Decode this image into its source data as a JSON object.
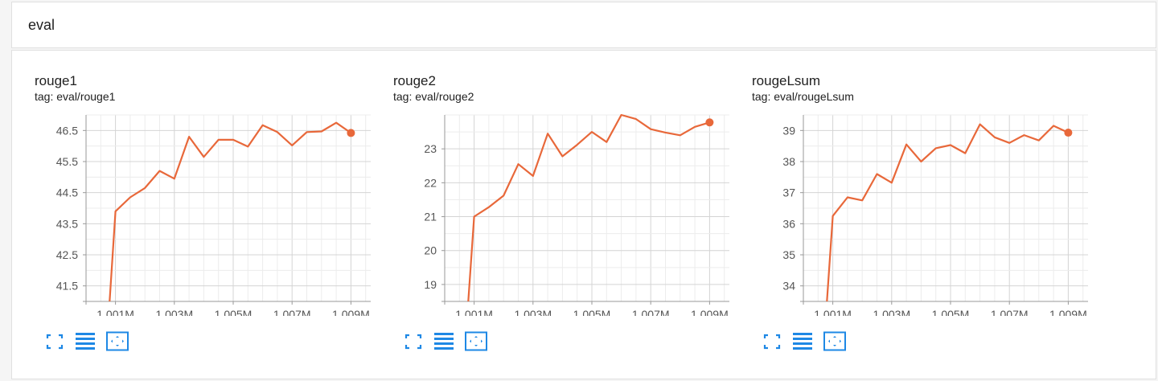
{
  "group": {
    "title": "eval"
  },
  "cards": [
    {
      "title": "rouge1",
      "tag": "tag: eval/rouge1",
      "yticks": [
        "46.5",
        "45.5",
        "44.5",
        "43.5",
        "42.5",
        "41.5"
      ],
      "xticks": [
        "1.001M",
        "1.003M",
        "1.005M",
        "1.007M",
        "1.009M"
      ]
    },
    {
      "title": "rouge2",
      "tag": "tag: eval/rouge2",
      "yticks": [
        "23",
        "22",
        "21",
        "20",
        "19"
      ],
      "xticks": [
        "1.001M",
        "1.003M",
        "1.005M",
        "1.007M",
        "1.009M"
      ]
    },
    {
      "title": "rougeLsum",
      "tag": "tag: eval/rougeLsum",
      "yticks": [
        "39",
        "38",
        "37",
        "36",
        "35",
        "34"
      ],
      "xticks": [
        "1.001M",
        "1.003M",
        "1.005M",
        "1.007M",
        "1.009M"
      ]
    }
  ],
  "actions": {
    "fullscreen_icon": "expand-icon",
    "data_icon": "data-table-icon",
    "fit_icon": "fit-domain-icon"
  },
  "colors": {
    "line": "#e8683a",
    "grid": "#dddddd",
    "axis": "#999999",
    "icon": "#1e88e5"
  },
  "chart_data": [
    {
      "type": "line",
      "title": "rouge1",
      "subtitle": "tag: eval/rouge1",
      "xlim": [
        1000000,
        1010000
      ],
      "ylim": [
        41,
        47
      ],
      "xticks": [
        1001000,
        1003000,
        1005000,
        1007000,
        1009000
      ],
      "yticks": [
        46.5,
        45.5,
        44.5,
        43.5,
        42.5,
        41.5
      ],
      "grid": true,
      "series": [
        {
          "x": [
            1000800,
            1001000,
            1001500,
            1002000,
            1002500,
            1003000,
            1003500,
            1004000,
            1004500,
            1005000,
            1005500,
            1006000,
            1006500,
            1007000,
            1007500,
            1008000,
            1008500,
            1009000
          ],
          "y": [
            41.0,
            43.9,
            44.35,
            44.65,
            45.2,
            44.95,
            46.3,
            45.65,
            46.2,
            46.2,
            45.98,
            46.67,
            46.45,
            46.02,
            46.45,
            46.47,
            46.75,
            46.42
          ]
        }
      ]
    },
    {
      "type": "line",
      "title": "rouge2",
      "subtitle": "tag: eval/rouge2",
      "xlim": [
        1000000,
        1010000
      ],
      "ylim": [
        18.5,
        24
      ],
      "xticks": [
        1001000,
        1003000,
        1005000,
        1007000,
        1009000
      ],
      "yticks": [
        23,
        22,
        21,
        20,
        19
      ],
      "grid": true,
      "series": [
        {
          "x": [
            1000800,
            1001000,
            1001500,
            1002000,
            1002500,
            1003000,
            1003500,
            1004000,
            1004500,
            1005000,
            1005500,
            1006000,
            1006500,
            1007000,
            1007500,
            1008000,
            1008500,
            1009000
          ],
          "y": [
            18.5,
            21.0,
            21.28,
            21.62,
            22.55,
            22.2,
            23.45,
            22.78,
            23.12,
            23.5,
            23.2,
            24.0,
            23.88,
            23.58,
            23.48,
            23.4,
            23.65,
            23.78
          ]
        }
      ]
    },
    {
      "type": "line",
      "title": "rougeLsum",
      "subtitle": "tag: eval/rougeLsum",
      "xlim": [
        1000000,
        1010000
      ],
      "ylim": [
        33.5,
        39.5
      ],
      "xticks": [
        1001000,
        1003000,
        1005000,
        1007000,
        1009000
      ],
      "yticks": [
        39,
        38,
        37,
        36,
        35,
        34
      ],
      "grid": true,
      "series": [
        {
          "x": [
            1000800,
            1001000,
            1001500,
            1002000,
            1002500,
            1003000,
            1003500,
            1004000,
            1004500,
            1005000,
            1005500,
            1006000,
            1006500,
            1007000,
            1007500,
            1008000,
            1008500,
            1009000
          ],
          "y": [
            33.5,
            36.25,
            36.85,
            36.75,
            37.6,
            37.32,
            38.55,
            38.0,
            38.43,
            38.53,
            38.27,
            39.2,
            38.78,
            38.6,
            38.85,
            38.68,
            39.15,
            38.93
          ]
        }
      ]
    }
  ]
}
